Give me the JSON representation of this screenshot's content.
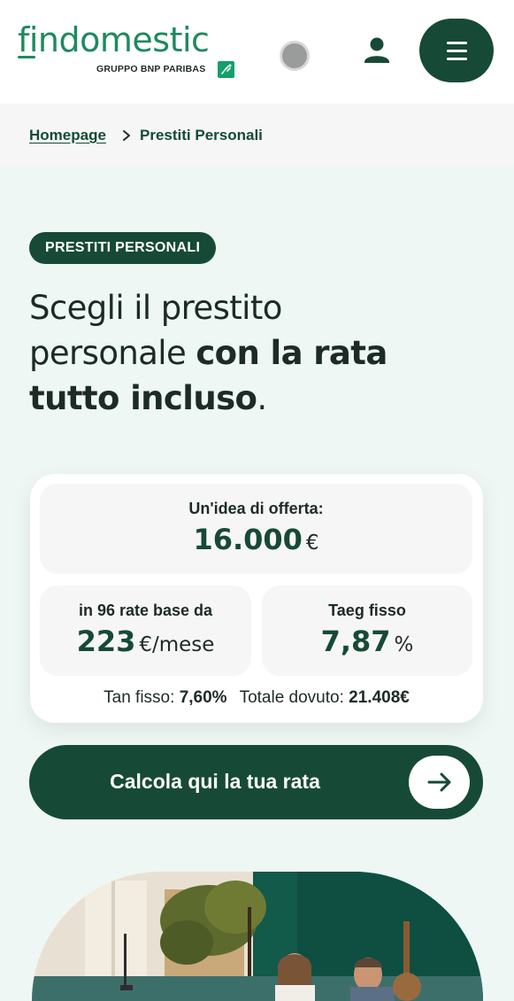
{
  "brand": {
    "name": "findomestic",
    "group": "GRUPPO BNP PARIBAS"
  },
  "header": {
    "icons": [
      "status-dot",
      "user-icon",
      "menu-icon"
    ]
  },
  "breadcrumb": {
    "home": "Homepage",
    "current": "Prestiti Personali"
  },
  "hero": {
    "tag": "PRESTITI PERSONALI",
    "title_light": "Scegli il prestito personale ",
    "title_bold": "con la rata tutto incluso",
    "title_end": "."
  },
  "offer": {
    "amount_label": "Un'idea di offerta:",
    "amount_value": "16.000",
    "amount_unit": "€",
    "installments_label": "in 96 rate base da",
    "installment_value": "223",
    "installment_unit": "€/mese",
    "taeg_label": "Taeg fisso",
    "taeg_value": "7,87",
    "taeg_unit": "%",
    "tan_label": "Tan fisso:",
    "tan_value": "7,60%",
    "total_label": "Totale dovuto:",
    "total_value": "21.408€"
  },
  "cta": {
    "label": "Calcola qui la tua rata"
  },
  "colors": {
    "brand_green": "#1e8a5f",
    "dark_green": "#164a36",
    "page_bg": "#eef7f3",
    "card_bg": "#ffffff",
    "box_bg": "#f6f6f6"
  }
}
